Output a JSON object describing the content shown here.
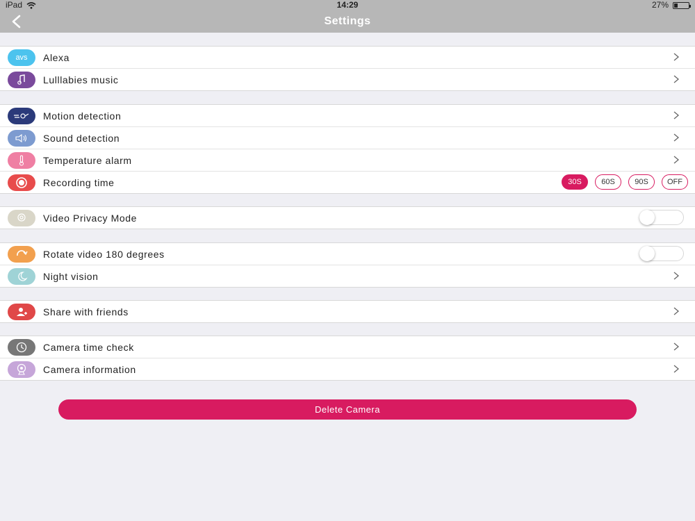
{
  "statusbar": {
    "device": "iPad",
    "time": "14:29",
    "battery_text": "27%",
    "battery_level": 0.27
  },
  "navbar": {
    "title": "Settings"
  },
  "groups": [
    [
      {
        "label": "Alexa",
        "icon": "avs-icon",
        "icon_text": "avs",
        "color": "#4cc3ee",
        "accessory": "chevron"
      },
      {
        "label": "Lulllabies music",
        "icon": "music-note-icon",
        "color": "#7a4a9c",
        "accessory": "chevron"
      }
    ],
    [
      {
        "label": "Motion detection",
        "icon": "motion-icon",
        "color": "#2b3a7a",
        "accessory": "chevron"
      },
      {
        "label": "Sound detection",
        "icon": "speaker-icon",
        "color": "#7d9bd0",
        "accessory": "chevron"
      },
      {
        "label": "Temperature alarm",
        "icon": "thermometer-icon",
        "color": "#ef7fa3",
        "accessory": "chevron"
      },
      {
        "label": "Recording time",
        "icon": "record-icon",
        "color": "#e84c4c",
        "accessory": "pills"
      }
    ],
    [
      {
        "label": "Video Privacy Mode",
        "icon": "privacy-icon",
        "color": "#d9d6c8",
        "accessory": "toggle"
      }
    ],
    [
      {
        "label": "Rotate video 180 degrees",
        "icon": "rotate-icon",
        "color": "#f2a04e",
        "accessory": "toggle"
      },
      {
        "label": "Night vision",
        "icon": "night-vision-icon",
        "color": "#9fd3d6",
        "accessory": "chevron"
      }
    ],
    [
      {
        "label": "Share with friends",
        "icon": "share-friends-icon",
        "color": "#e04848",
        "accessory": "chevron"
      }
    ],
    [
      {
        "label": "Camera time check",
        "icon": "clock-icon",
        "color": "#777777",
        "accessory": "chevron"
      },
      {
        "label": "Camera information",
        "icon": "camera-info-icon",
        "color": "#c6a6d9",
        "accessory": "chevron"
      }
    ]
  ],
  "recording_options": [
    {
      "label": "30S",
      "selected": true
    },
    {
      "label": "60S",
      "selected": false
    },
    {
      "label": "90S",
      "selected": false
    },
    {
      "label": "OFF",
      "selected": false
    }
  ],
  "delete_button": {
    "label": "Delete Camera",
    "color": "#d81b60"
  }
}
